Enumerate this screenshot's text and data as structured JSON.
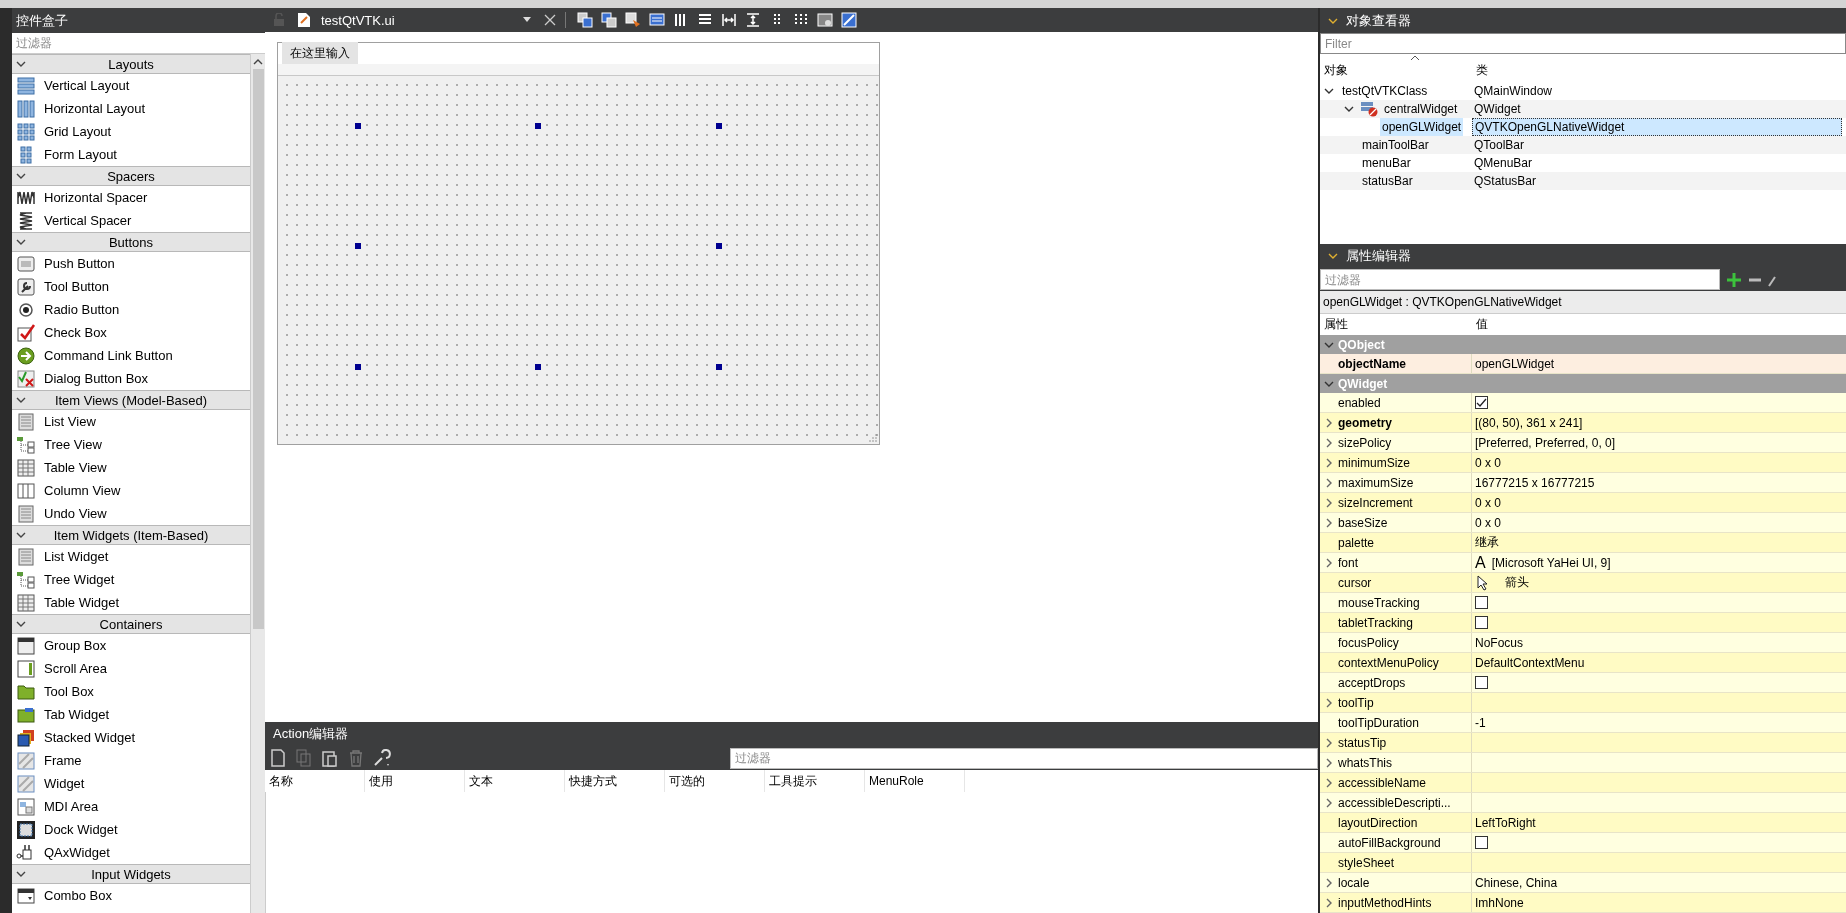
{
  "widget_box": {
    "title": "控件盒子",
    "filter_placeholder": "过滤器",
    "categories": [
      {
        "name": "Layouts",
        "expanded": true,
        "items": [
          "Vertical Layout",
          "Horizontal Layout",
          "Grid Layout",
          "Form Layout"
        ]
      },
      {
        "name": "Spacers",
        "expanded": true,
        "items": [
          "Horizontal Spacer",
          "Vertical Spacer"
        ]
      },
      {
        "name": "Buttons",
        "expanded": true,
        "items": [
          "Push Button",
          "Tool Button",
          "Radio Button",
          "Check Box",
          "Command Link Button",
          "Dialog Button Box"
        ]
      },
      {
        "name": "Item Views (Model-Based)",
        "expanded": true,
        "items": [
          "List View",
          "Tree View",
          "Table View",
          "Column View",
          "Undo View"
        ]
      },
      {
        "name": "Item Widgets (Item-Based)",
        "expanded": true,
        "items": [
          "List Widget",
          "Tree Widget",
          "Table Widget"
        ]
      },
      {
        "name": "Containers",
        "expanded": true,
        "items": [
          "Group Box",
          "Scroll Area",
          "Tool Box",
          "Tab Widget",
          "Stacked Widget",
          "Frame",
          "Widget",
          "MDI Area",
          "Dock Widget",
          "QAxWidget"
        ]
      },
      {
        "name": "Input Widgets",
        "expanded": true,
        "items": [
          "Combo Box"
        ]
      }
    ]
  },
  "form_editor": {
    "file_name": "testQtVTK.ui",
    "menu_placeholder": "在这里输入"
  },
  "action_editor": {
    "title": "Action编辑器",
    "filter_placeholder": "过滤器",
    "columns": [
      "名称",
      "使用",
      "文本",
      "快捷方式",
      "可选的",
      "工具提示",
      "MenuRole"
    ]
  },
  "object_inspector": {
    "title": "对象查看器",
    "filter_placeholder": "Filter",
    "columns": [
      "对象",
      "类"
    ],
    "tree": [
      {
        "name": "testQtVTKClass",
        "class": "QMainWindow",
        "expanded": true,
        "selected": false,
        "children": [
          {
            "name": "centralWidget",
            "class": "QWidget",
            "expanded": true,
            "selected": false,
            "children": [
              {
                "name": "openGLWidget",
                "class": "QVTKOpenGLNativeWidget",
                "selected": true
              }
            ]
          },
          {
            "name": "mainToolBar",
            "class": "QToolBar",
            "selected": false
          },
          {
            "name": "menuBar",
            "class": "QMenuBar",
            "selected": false
          },
          {
            "name": "statusBar",
            "class": "QStatusBar",
            "selected": false
          }
        ]
      }
    ]
  },
  "property_editor": {
    "title": "属性编辑器",
    "filter_placeholder": "过滤器",
    "subject": "openGLWidget : QVTKOpenGLNativeWidget",
    "columns": [
      "属性",
      "值"
    ],
    "groups": [
      {
        "name": "QObject",
        "expanded": true,
        "properties": [
          {
            "name": "objectName",
            "kind": "text",
            "value": "openGLWidget",
            "modified": true,
            "expandable": false
          }
        ]
      },
      {
        "name": "QWidget",
        "expanded": true,
        "properties": [
          {
            "name": "enabled",
            "kind": "checkbox",
            "checked": true,
            "modified": false,
            "expandable": false
          },
          {
            "name": "geometry",
            "kind": "text",
            "value": "[(80, 50), 361 x 241]",
            "modified": true,
            "expandable": true
          },
          {
            "name": "sizePolicy",
            "kind": "text",
            "value": "[Preferred, Preferred, 0, 0]",
            "modified": false,
            "expandable": true
          },
          {
            "name": "minimumSize",
            "kind": "text",
            "value": "0 x 0",
            "modified": false,
            "expandable": true
          },
          {
            "name": "maximumSize",
            "kind": "text",
            "value": "16777215 x 16777215",
            "modified": false,
            "expandable": true
          },
          {
            "name": "sizeIncrement",
            "kind": "text",
            "value": "0 x 0",
            "modified": false,
            "expandable": true
          },
          {
            "name": "baseSize",
            "kind": "text",
            "value": "0 x 0",
            "modified": false,
            "expandable": true
          },
          {
            "name": "palette",
            "kind": "text",
            "value": "继承",
            "modified": false,
            "expandable": false
          },
          {
            "name": "font",
            "kind": "font",
            "glyph": "A",
            "value": "[Microsoft YaHei UI, 9]",
            "modified": false,
            "expandable": true
          },
          {
            "name": "cursor",
            "kind": "cursor",
            "value": "箭头",
            "modified": false,
            "expandable": false
          },
          {
            "name": "mouseTracking",
            "kind": "checkbox",
            "checked": false,
            "modified": false,
            "expandable": false
          },
          {
            "name": "tabletTracking",
            "kind": "checkbox",
            "checked": false,
            "modified": false,
            "expandable": false
          },
          {
            "name": "focusPolicy",
            "kind": "text",
            "value": "NoFocus",
            "modified": false,
            "expandable": false
          },
          {
            "name": "contextMenuPolicy",
            "kind": "text",
            "value": "DefaultContextMenu",
            "modified": false,
            "expandable": false
          },
          {
            "name": "acceptDrops",
            "kind": "checkbox",
            "checked": false,
            "modified": false,
            "expandable": false
          },
          {
            "name": "toolTip",
            "kind": "text",
            "modified": false,
            "expandable": true
          },
          {
            "name": "toolTipDuration",
            "kind": "text",
            "value": "-1",
            "modified": false,
            "expandable": false
          },
          {
            "name": "statusTip",
            "kind": "text",
            "modified": false,
            "expandable": true
          },
          {
            "name": "whatsThis",
            "kind": "text",
            "modified": false,
            "expandable": true
          },
          {
            "name": "accessibleName",
            "kind": "text",
            "modified": false,
            "expandable": true
          },
          {
            "name": "accessibleDescripti...",
            "kind": "text",
            "modified": false,
            "expandable": true
          },
          {
            "name": "layoutDirection",
            "kind": "text",
            "value": "LeftToRight",
            "modified": false,
            "expandable": false
          },
          {
            "name": "autoFillBackground",
            "kind": "checkbox",
            "checked": false,
            "modified": false,
            "expandable": false
          },
          {
            "name": "styleSheet",
            "kind": "text",
            "modified": false,
            "expandable": false
          },
          {
            "name": "locale",
            "kind": "text",
            "value": "Chinese, China",
            "modified": false,
            "expandable": true
          },
          {
            "name": "inputMethodHints",
            "kind": "text",
            "value": "ImhNone",
            "modified": false,
            "expandable": true
          }
        ]
      }
    ]
  }
}
